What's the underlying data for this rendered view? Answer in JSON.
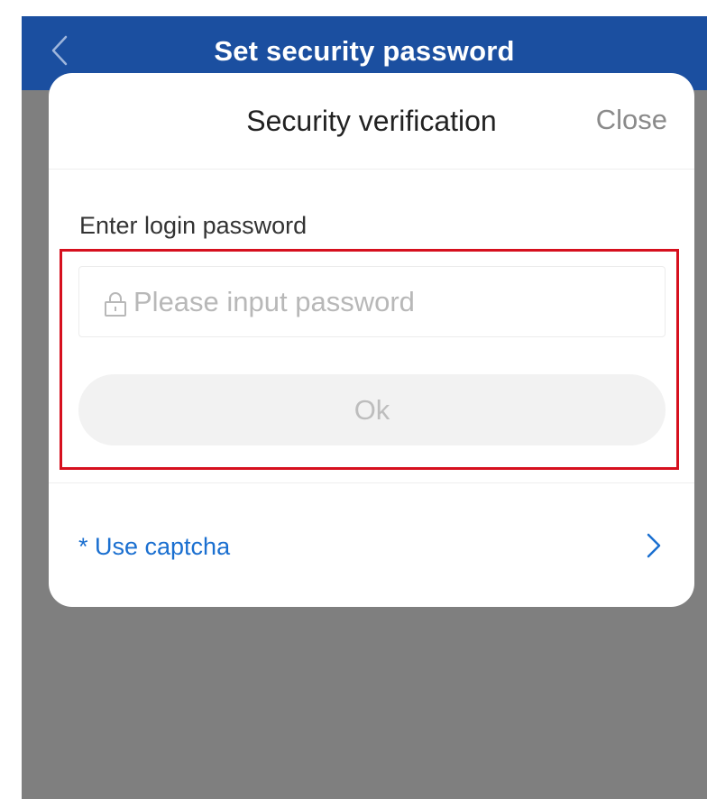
{
  "navbar": {
    "title": "Set security password",
    "back_icon": "chevron-left-icon",
    "background": "#1b4fa0"
  },
  "modal": {
    "title": "Security verification",
    "close_label": "Close",
    "field_label": "Enter login password",
    "password": {
      "value": "",
      "placeholder": "Please input password",
      "icon": "lock-icon"
    },
    "ok_label": "Ok",
    "captcha_link": "* Use captcha",
    "captcha_icon": "chevron-right-icon",
    "link_color": "#1a6fd0",
    "highlight_color": "#d6101e"
  }
}
